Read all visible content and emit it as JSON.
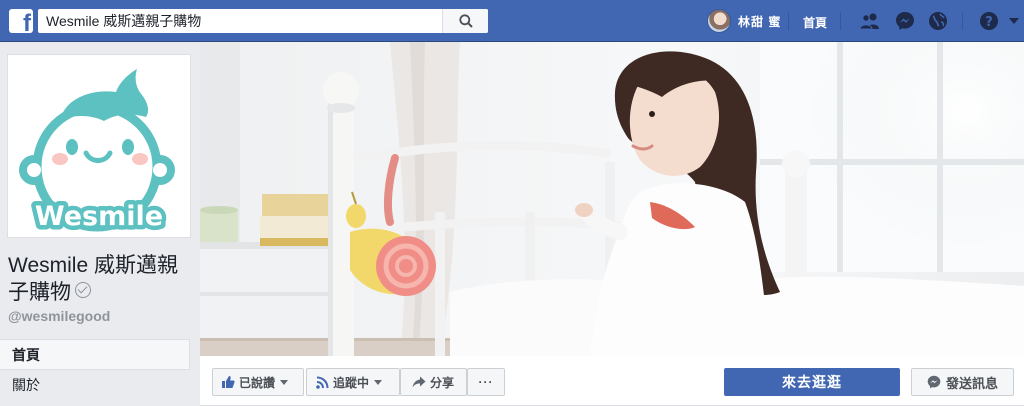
{
  "topbar": {
    "logo_letter": "f",
    "search_value": "Wesmile 威斯邁親子購物",
    "profile_name": "林甜 蜜",
    "home_label": "首頁",
    "icons": [
      "friend-requests-icon",
      "messenger-icon",
      "notifications-globe-icon",
      "help-icon",
      "account-menu-icon"
    ],
    "accent_color": "#4267b2"
  },
  "page": {
    "logo_text": "Wesmile",
    "name": "Wesmile 威斯邁親子購物",
    "handle": "@wesmilegood"
  },
  "left_nav": {
    "items": [
      {
        "label": "首頁",
        "active": true
      },
      {
        "label": "關於",
        "active": false
      }
    ]
  },
  "actions": {
    "like_label": "已說讚",
    "follow_label": "追蹤中",
    "share_label": "分享",
    "more_label": "···",
    "shop_label": "來去逛逛",
    "message_label": "發送訊息"
  }
}
